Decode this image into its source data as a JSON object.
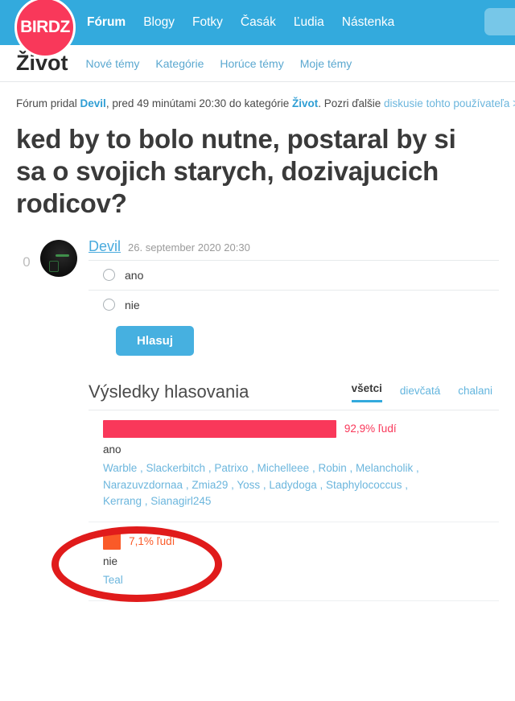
{
  "navbar": {
    "logo_text": "BIRDZ",
    "brand_color": "#f9385a",
    "bg_color": "#33aadd",
    "links": [
      {
        "label": "Fórum",
        "active": true
      },
      {
        "label": "Blogy",
        "active": false
      },
      {
        "label": "Fotky",
        "active": false
      },
      {
        "label": "Časák",
        "active": false
      },
      {
        "label": "Ľudia",
        "active": false
      },
      {
        "label": "Nástenka",
        "active": false
      }
    ],
    "search_icon": "search-box"
  },
  "subnav": {
    "title": "Život",
    "links": [
      {
        "label": "Nové témy"
      },
      {
        "label": "Kategórie"
      },
      {
        "label": "Horúce témy"
      },
      {
        "label": "Moje témy"
      }
    ]
  },
  "meta": {
    "prefix": "Fórum pridal ",
    "author": "Devil",
    "middle": ", pred 49 minútami 20:30 do kategórie ",
    "category": "Život",
    "after": ". Pozri ďalšie ",
    "more_link": "diskusie tohto používateľa >"
  },
  "post": {
    "title": "ked by to bolo nutne, postaral by si sa o svojich starych, dozivajucich rodicov?",
    "vote_count": "0",
    "author": "Devil",
    "date": "26. september 2020 20:30",
    "options": [
      {
        "label": "ano"
      },
      {
        "label": "nie"
      }
    ],
    "vote_button": "Hlasuj"
  },
  "results": {
    "title": "Výsledky hlasovania",
    "tabs": [
      {
        "label": "všetci",
        "active": true
      },
      {
        "label": "dievčatá",
        "active": false
      },
      {
        "label": "chalani",
        "active": false
      }
    ]
  },
  "chart_data": {
    "type": "bar",
    "title": "Výsledky hlasovania",
    "categories": [
      "ano",
      "nie"
    ],
    "values": [
      92.9,
      7.1
    ],
    "value_labels": [
      "92,9% ľudí",
      "7,1% ľudí"
    ],
    "unit": "%",
    "colors": [
      "#f9385a",
      "#fa5a28"
    ],
    "orientation": "horizontal",
    "xlim": [
      0,
      100
    ],
    "grid": false,
    "legend": false,
    "voters": [
      [
        "Warble",
        "Slackerbitch",
        "Patrixo",
        "Michelleee",
        "Robin",
        "Melancholik",
        "Narazuvzdornaa",
        "Zmia29",
        "Yoss",
        "Ladydoga",
        "Staphylococcus",
        "Kerrang",
        "Sianagirl245"
      ],
      [
        "Teal"
      ]
    ]
  },
  "annotation": {
    "shape": "ellipse",
    "color": "#e01b1b"
  }
}
